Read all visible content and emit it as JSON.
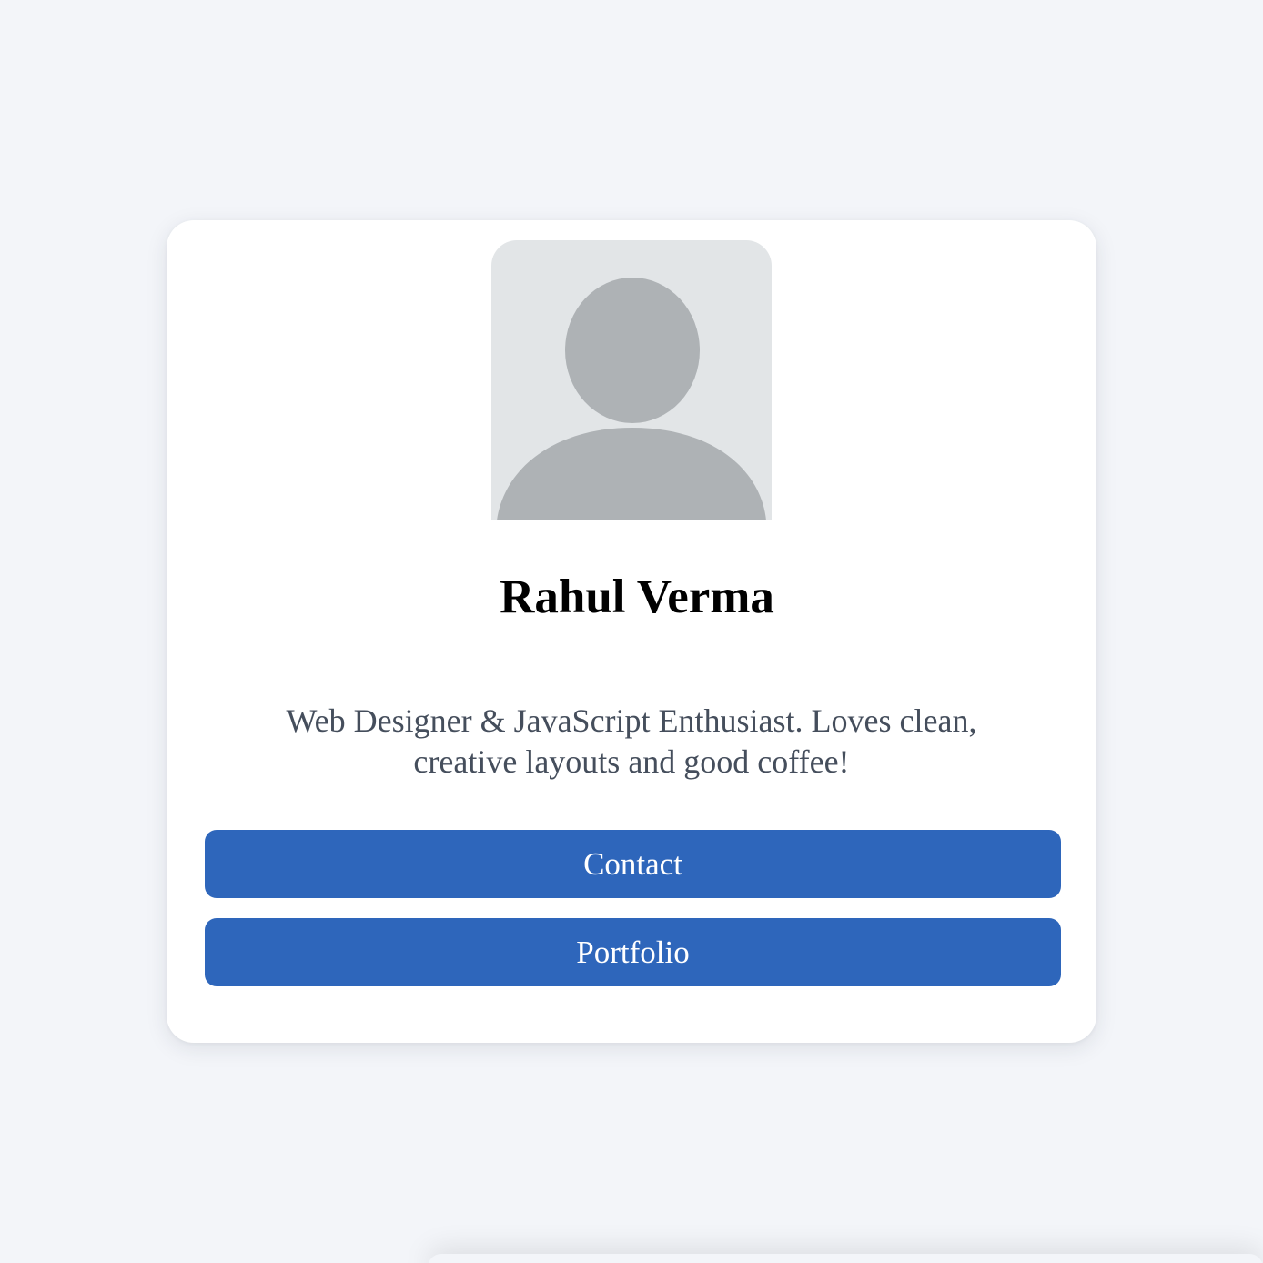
{
  "profile": {
    "avatar_icon": "user-silhouette-icon",
    "name": "Rahul Verma",
    "bio": "Web Designer & JavaScript Enthusiast. Loves clean, creative layouts and good coffee!"
  },
  "actions": {
    "contact_label": "Contact",
    "portfolio_label": "Portfolio"
  },
  "colors": {
    "background": "#f3f5f9",
    "card": "#ffffff",
    "button": "#2e66bb",
    "bio_text": "#454e5c",
    "avatar_bg": "#e2e5e7",
    "avatar_figure": "#aeb2b5"
  }
}
